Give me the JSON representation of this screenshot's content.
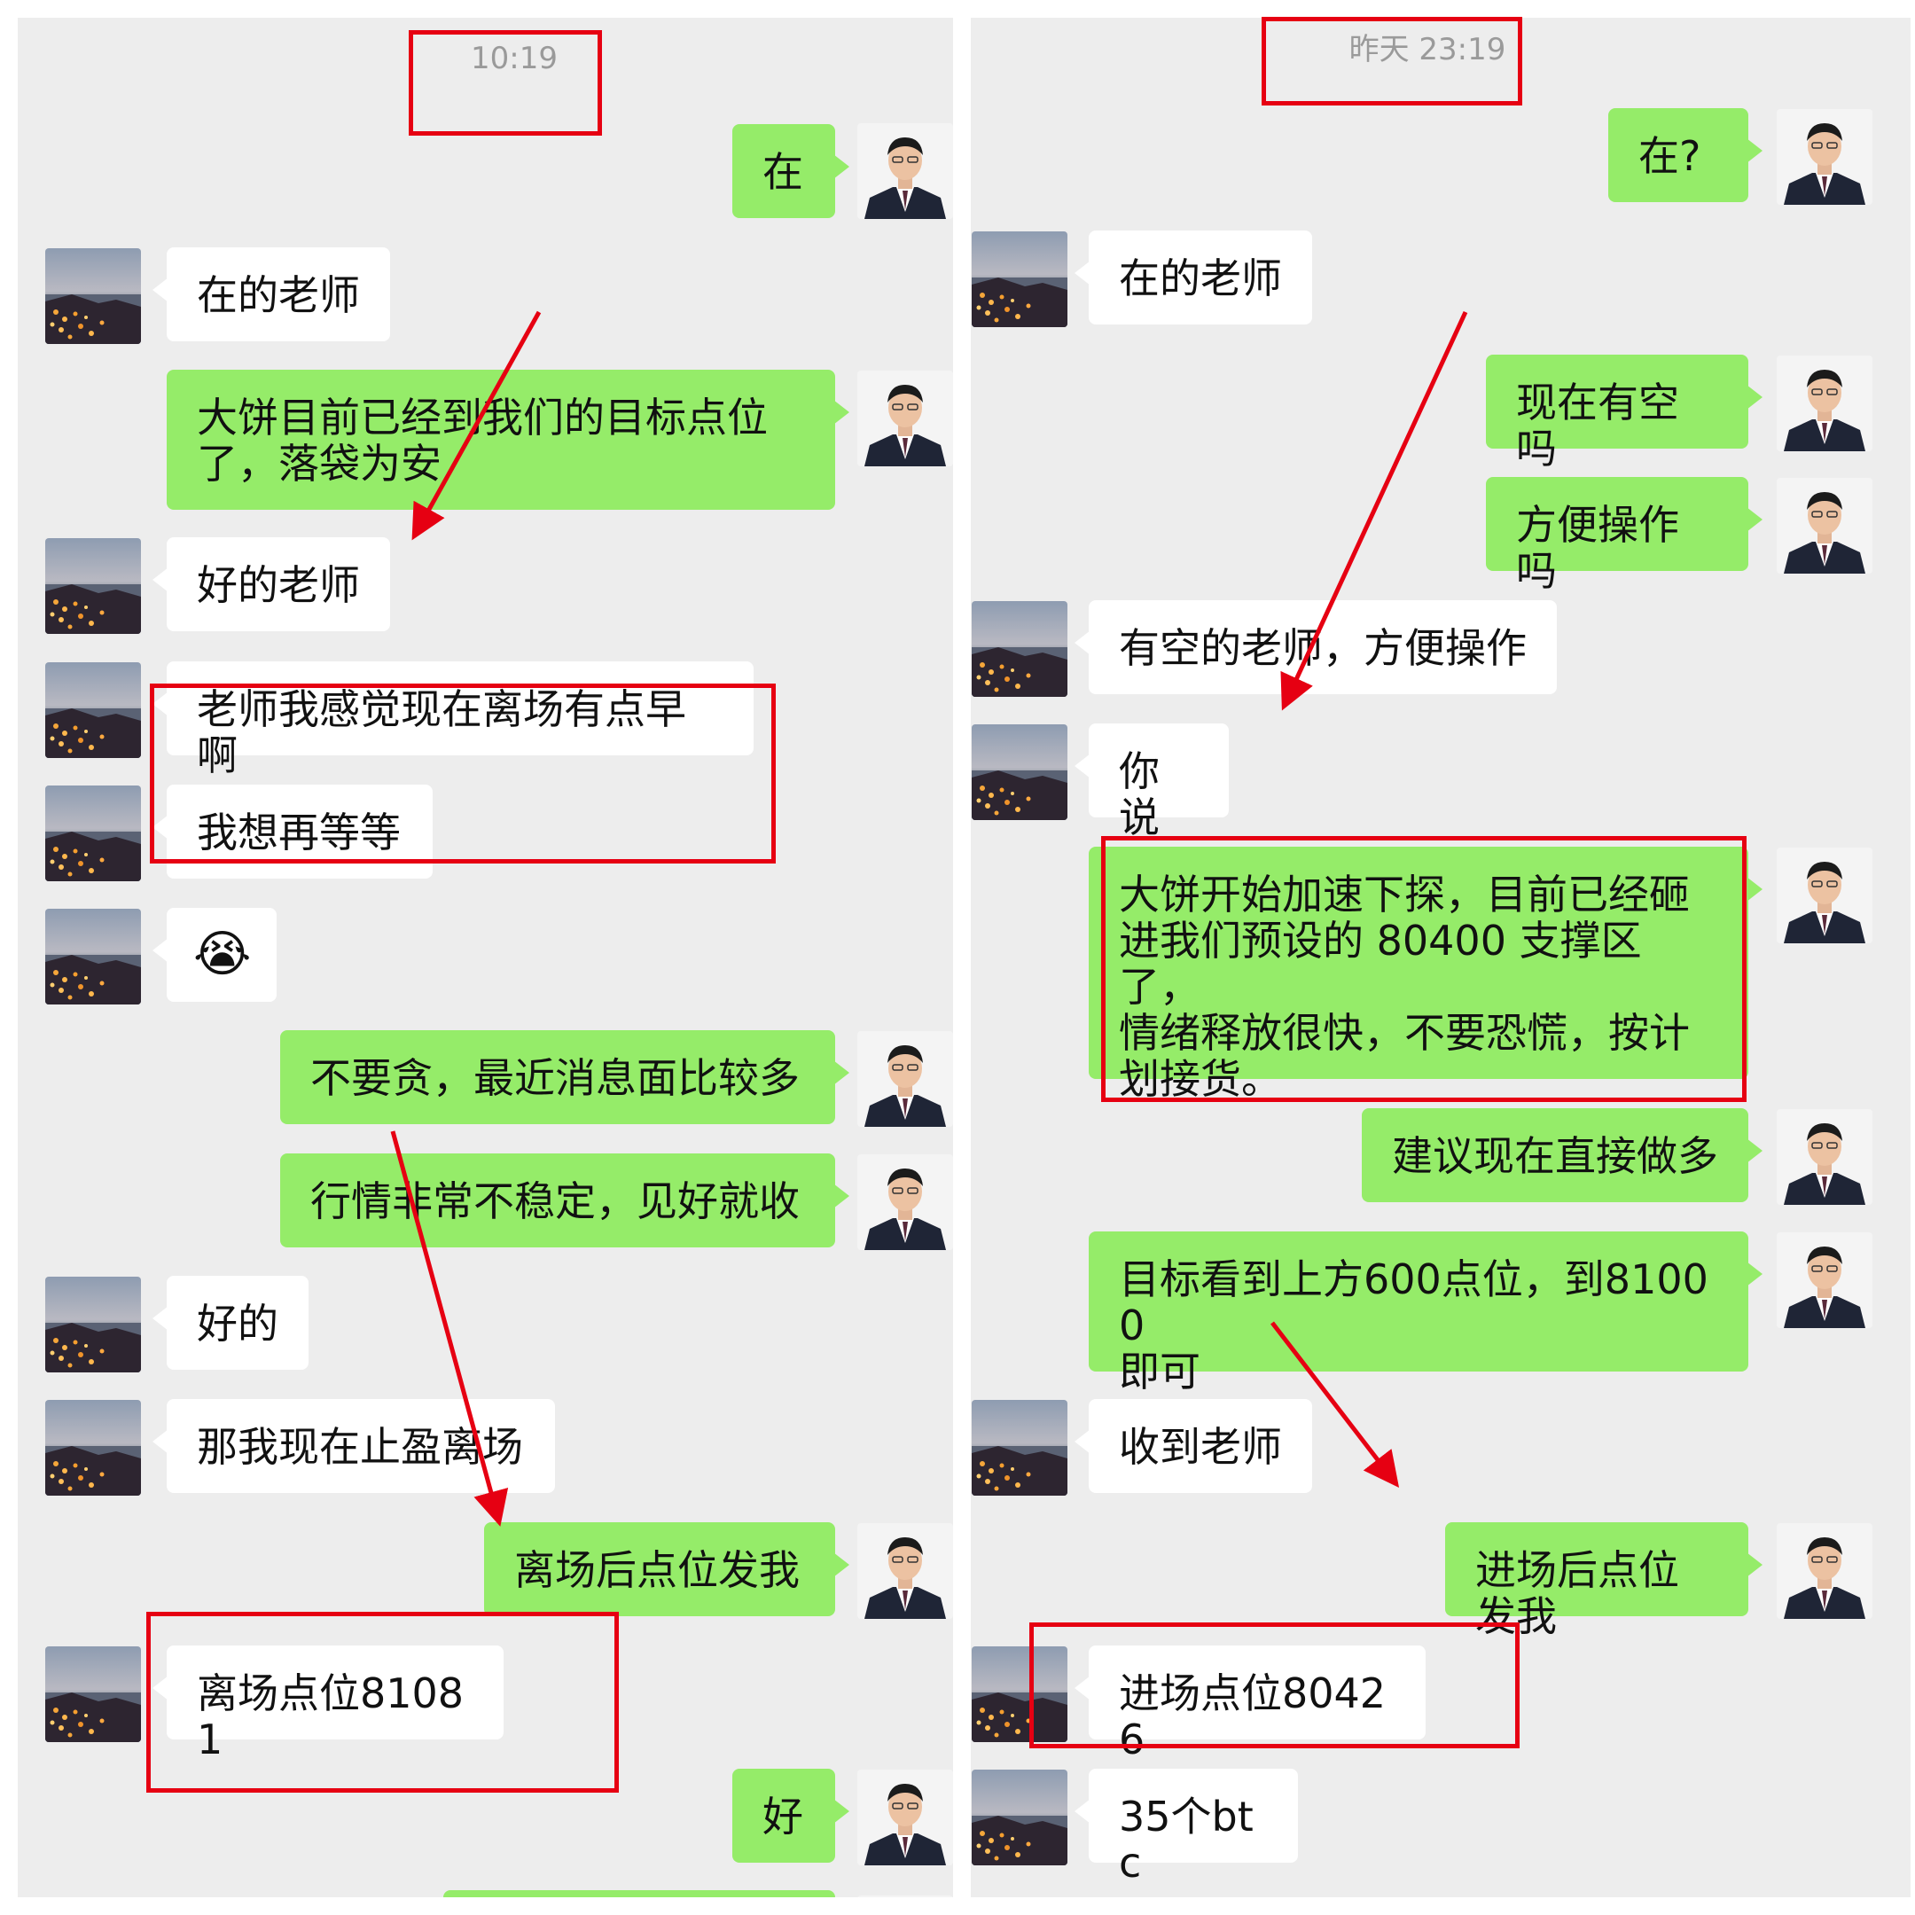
{
  "left_chat": {
    "timestamp": "10:19",
    "messages": [
      {
        "side": "out",
        "text": "在"
      },
      {
        "side": "in",
        "text": "在的老师"
      },
      {
        "side": "out",
        "text": "大饼目前已经到我们的目标点位\n了，落袋为安"
      },
      {
        "side": "in",
        "text": "好的老师"
      },
      {
        "side": "in",
        "text": "老师我感觉现在离场有点早啊"
      },
      {
        "side": "in",
        "text": "我想再等等"
      },
      {
        "side": "in",
        "text": "😭"
      },
      {
        "side": "out",
        "text": "不要贪，最近消息面比较多"
      },
      {
        "side": "out",
        "text": "行情非常不稳定，见好就收"
      },
      {
        "side": "in",
        "text": "好的"
      },
      {
        "side": "in",
        "text": "那我现在止盈离场"
      },
      {
        "side": "out",
        "text": "离场后点位发我"
      },
      {
        "side": "in",
        "text": "离场点位81081"
      },
      {
        "side": "out",
        "text": "好"
      }
    ]
  },
  "right_chat": {
    "timestamp": "昨天 23:19",
    "messages": [
      {
        "side": "out",
        "text": "在?"
      },
      {
        "side": "in",
        "text": "在的老师"
      },
      {
        "side": "out",
        "text": "现在有空吗"
      },
      {
        "side": "out",
        "text": "方便操作吗"
      },
      {
        "side": "in",
        "text": "有空的老师，方便操作"
      },
      {
        "side": "in",
        "text": "你说"
      },
      {
        "side": "out",
        "text": "大饼开始加速下探，目前已经砸\n进我们预设的 80400 支撑区了，\n情绪释放很快，不要恐慌，按计\n划接货。"
      },
      {
        "side": "out",
        "text": "建议现在直接做多"
      },
      {
        "side": "out",
        "text": "目标看到上方600点位，到81000\n即可"
      },
      {
        "side": "in",
        "text": "收到老师"
      },
      {
        "side": "out",
        "text": "进场后点位发我"
      },
      {
        "side": "in",
        "text": "进场点位80426"
      },
      {
        "side": "in",
        "text": "35个btc"
      }
    ]
  },
  "colors": {
    "chat_bg": "#ededed",
    "outgoing_bubble": "#95ec69",
    "incoming_bubble": "#ffffff",
    "annotation_red": "#e60012"
  },
  "icons": {
    "self_avatar": "man-in-suit-avatar",
    "contact_avatar": "night-city-coast-avatar"
  }
}
